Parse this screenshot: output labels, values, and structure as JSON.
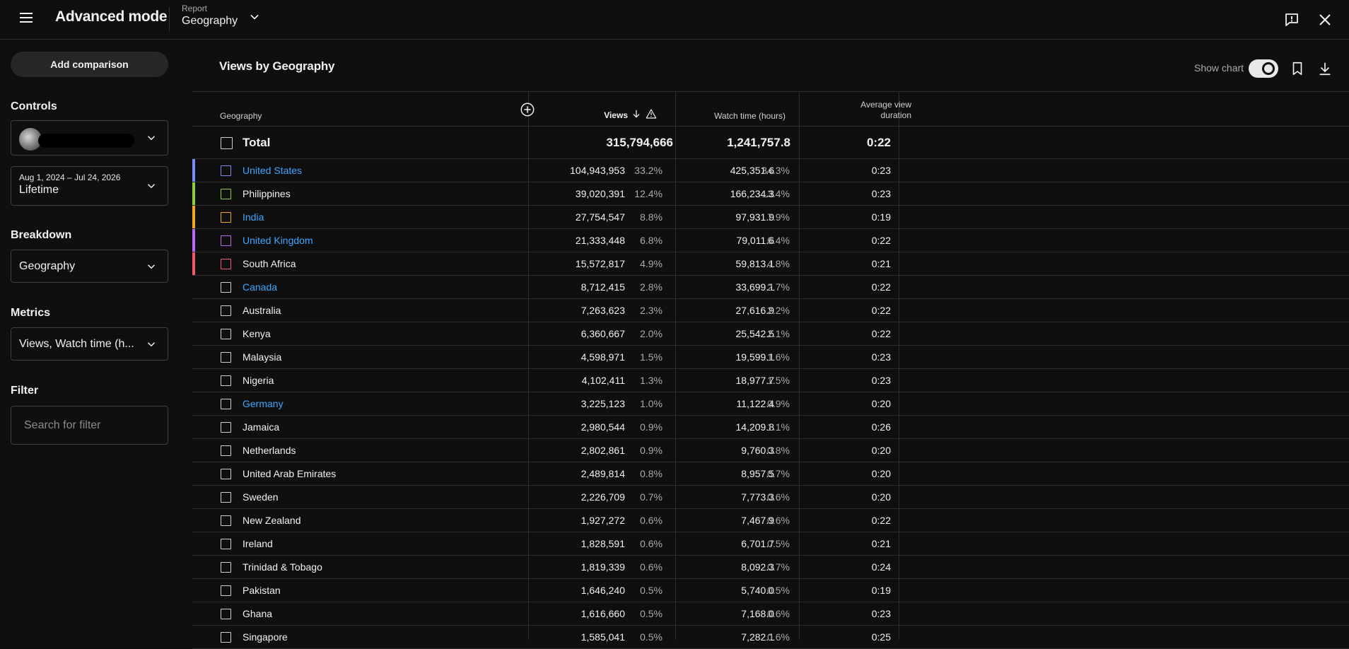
{
  "app": {
    "title": "Advanced mode"
  },
  "report": {
    "label": "Report",
    "value": "Geography"
  },
  "sidebar": {
    "add_comparison": "Add comparison",
    "controls_title": "Controls",
    "date_range": "Aug 1, 2024 – Jul 24, 2026",
    "date_value": "Lifetime",
    "breakdown_title": "Breakdown",
    "breakdown_value": "Geography",
    "metrics_title": "Metrics",
    "metrics_value": "Views, Watch time (h...",
    "filter_title": "Filter",
    "filter_placeholder": "Search for filter"
  },
  "main": {
    "title": "Views by Geography",
    "show_chart_label": "Show chart",
    "show_chart_on": true
  },
  "table": {
    "headers": {
      "geography": "Geography",
      "views": "Views",
      "watch_time": "Watch time (hours)",
      "avg_view_line1": "Average view",
      "avg_view_line2": "duration"
    },
    "total": {
      "label": "Total",
      "views": "315,794,666",
      "watch": "1,241,757.8",
      "avg": "0:22"
    },
    "rows": [
      {
        "name": "United States",
        "views": "104,943,953",
        "views_pct": "33.2%",
        "watch": "425,351.6",
        "watch_pct": "34.3%",
        "avg": "0:23",
        "link": true,
        "color": "#7b8cf4"
      },
      {
        "name": "Philippines",
        "views": "39,020,391",
        "views_pct": "12.4%",
        "watch": "166,234.3",
        "watch_pct": "13.4%",
        "avg": "0:23",
        "link": false,
        "color": "#8fcf3a"
      },
      {
        "name": "India",
        "views": "27,754,547",
        "views_pct": "8.8%",
        "watch": "97,931.9",
        "watch_pct": "7.9%",
        "avg": "0:19",
        "link": true,
        "color": "#f5a524"
      },
      {
        "name": "United Kingdom",
        "views": "21,333,448",
        "views_pct": "6.8%",
        "watch": "79,011.6",
        "watch_pct": "6.4%",
        "avg": "0:22",
        "link": true,
        "color": "#b56af2"
      },
      {
        "name": "South Africa",
        "views": "15,572,817",
        "views_pct": "4.9%",
        "watch": "59,813.1",
        "watch_pct": "4.8%",
        "avg": "0:21",
        "link": false,
        "color": "#ef5b6e"
      },
      {
        "name": "Canada",
        "views": "8,712,415",
        "views_pct": "2.8%",
        "watch": "33,699.1",
        "watch_pct": "2.7%",
        "avg": "0:22",
        "link": true,
        "color": ""
      },
      {
        "name": "Australia",
        "views": "7,263,623",
        "views_pct": "2.3%",
        "watch": "27,616.9",
        "watch_pct": "2.2%",
        "avg": "0:22",
        "link": false,
        "color": ""
      },
      {
        "name": "Kenya",
        "views": "6,360,667",
        "views_pct": "2.0%",
        "watch": "25,542.5",
        "watch_pct": "2.1%",
        "avg": "0:22",
        "link": false,
        "color": ""
      },
      {
        "name": "Malaysia",
        "views": "4,598,971",
        "views_pct": "1.5%",
        "watch": "19,599.1",
        "watch_pct": "1.6%",
        "avg": "0:23",
        "link": false,
        "color": ""
      },
      {
        "name": "Nigeria",
        "views": "4,102,411",
        "views_pct": "1.3%",
        "watch": "18,977.7",
        "watch_pct": "1.5%",
        "avg": "0:23",
        "link": false,
        "color": ""
      },
      {
        "name": "Germany",
        "views": "3,225,123",
        "views_pct": "1.0%",
        "watch": "11,122.4",
        "watch_pct": "0.9%",
        "avg": "0:20",
        "link": true,
        "color": ""
      },
      {
        "name": "Jamaica",
        "views": "2,980,544",
        "views_pct": "0.9%",
        "watch": "14,209.8",
        "watch_pct": "1.1%",
        "avg": "0:26",
        "link": false,
        "color": ""
      },
      {
        "name": "Netherlands",
        "views": "2,802,861",
        "views_pct": "0.9%",
        "watch": "9,760.3",
        "watch_pct": "0.8%",
        "avg": "0:20",
        "link": false,
        "color": ""
      },
      {
        "name": "United Arab Emirates",
        "views": "2,489,814",
        "views_pct": "0.8%",
        "watch": "8,957.5",
        "watch_pct": "0.7%",
        "avg": "0:20",
        "link": false,
        "color": ""
      },
      {
        "name": "Sweden",
        "views": "2,226,709",
        "views_pct": "0.7%",
        "watch": "7,773.3",
        "watch_pct": "0.6%",
        "avg": "0:20",
        "link": false,
        "color": ""
      },
      {
        "name": "New Zealand",
        "views": "1,927,272",
        "views_pct": "0.6%",
        "watch": "7,467.9",
        "watch_pct": "0.6%",
        "avg": "0:22",
        "link": false,
        "color": ""
      },
      {
        "name": "Ireland",
        "views": "1,828,591",
        "views_pct": "0.6%",
        "watch": "6,701.7",
        "watch_pct": "0.5%",
        "avg": "0:21",
        "link": false,
        "color": ""
      },
      {
        "name": "Trinidad & Tobago",
        "views": "1,819,339",
        "views_pct": "0.6%",
        "watch": "8,092.3",
        "watch_pct": "0.7%",
        "avg": "0:24",
        "link": false,
        "color": ""
      },
      {
        "name": "Pakistan",
        "views": "1,646,240",
        "views_pct": "0.5%",
        "watch": "5,740.0",
        "watch_pct": "0.5%",
        "avg": "0:19",
        "link": false,
        "color": ""
      },
      {
        "name": "Ghana",
        "views": "1,616,660",
        "views_pct": "0.5%",
        "watch": "7,168.0",
        "watch_pct": "0.6%",
        "avg": "0:23",
        "link": false,
        "color": ""
      },
      {
        "name": "Singapore",
        "views": "1,585,041",
        "views_pct": "0.5%",
        "watch": "7,282.1",
        "watch_pct": "0.6%",
        "avg": "0:25",
        "link": false,
        "color": ""
      }
    ]
  }
}
